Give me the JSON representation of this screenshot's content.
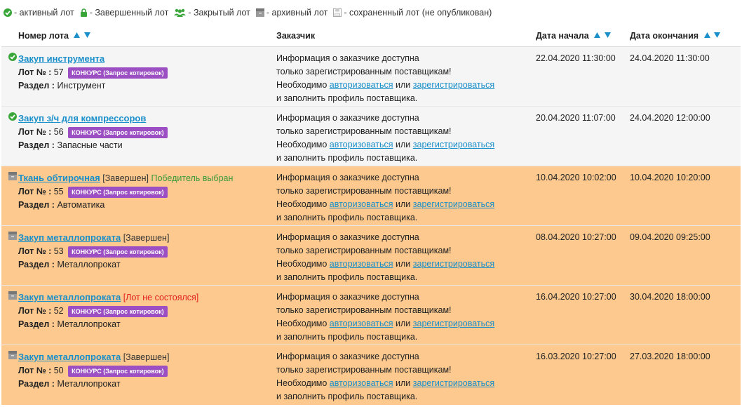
{
  "legend": {
    "active": "- активный лот",
    "completed": "- Завершенный лот",
    "closed": "- Закрытый лот",
    "archived": "- архивный лот",
    "saved": "- сохраненный лот (не опубликован)"
  },
  "columns": {
    "lot": "Номер лота",
    "customer": "Заказчик",
    "start": "Дата начала",
    "end": "Дата окончания"
  },
  "common": {
    "lot_label": "Лот №",
    "section_label": "Раздел",
    "badge": "КОНКУРС (Запрос котировок)",
    "info_line1": "Информация о заказчике доступна",
    "info_line2": "только зарегистрированным поставщикам!",
    "need": "Необходимо",
    "authorize": "авторизоваться",
    "or": "или",
    "register": "зарегистрироваться",
    "fill_profile": "и заполнить профиль поставщика."
  },
  "colors": {
    "link": "#1a8fc9",
    "archived_row": "#fdc98f",
    "active_row": "#f5f5f5",
    "badge": "#9b4fc2",
    "active_icon": "#3aa63a"
  },
  "rows": [
    {
      "state": "active",
      "icon": "check-circle-icon",
      "title": "Закуп инструмента",
      "status": "",
      "winner": "",
      "lot_no": "57",
      "section": "Инструмент",
      "start": "22.04.2020 11:30:00",
      "end": "24.04.2020 11:30:00"
    },
    {
      "state": "active",
      "icon": "check-circle-icon",
      "title": "Закуп з/ч для компрессоров",
      "status": "",
      "winner": "",
      "lot_no": "56",
      "section": "Запасные части",
      "start": "20.04.2020 11:07:00",
      "end": "24.04.2020 12:00:00"
    },
    {
      "state": "archived",
      "icon": "archive-icon",
      "title": "Ткань обтирочная",
      "status": "[Завершен]",
      "winner": "Победитель выбран",
      "lot_no": "55",
      "section": "Автоматика",
      "start": "10.04.2020 10:02:00",
      "end": "10.04.2020 10:20:00"
    },
    {
      "state": "archived",
      "icon": "archive-icon",
      "title": "Закуп металлопроката",
      "status": "[Завершен]",
      "winner": "",
      "lot_no": "53",
      "section": "Металлопрокат",
      "start": "08.04.2020 10:27:00",
      "end": "09.04.2020 09:25:00"
    },
    {
      "state": "archived",
      "icon": "archive-icon",
      "title": "Закуп металлопроката",
      "status_failed": "[Лот не состоялся]",
      "winner": "",
      "lot_no": "52",
      "section": "Металлопрокат",
      "start": "16.04.2020 10:27:00",
      "end": "30.04.2020 18:00:00"
    },
    {
      "state": "archived",
      "icon": "archive-icon",
      "title": "Закуп металлопроката",
      "status": "[Завершен]",
      "winner": "",
      "lot_no": "50",
      "section": "Металлопрокат",
      "start": "16.03.2020 10:27:00",
      "end": "27.03.2020 18:00:00"
    }
  ]
}
